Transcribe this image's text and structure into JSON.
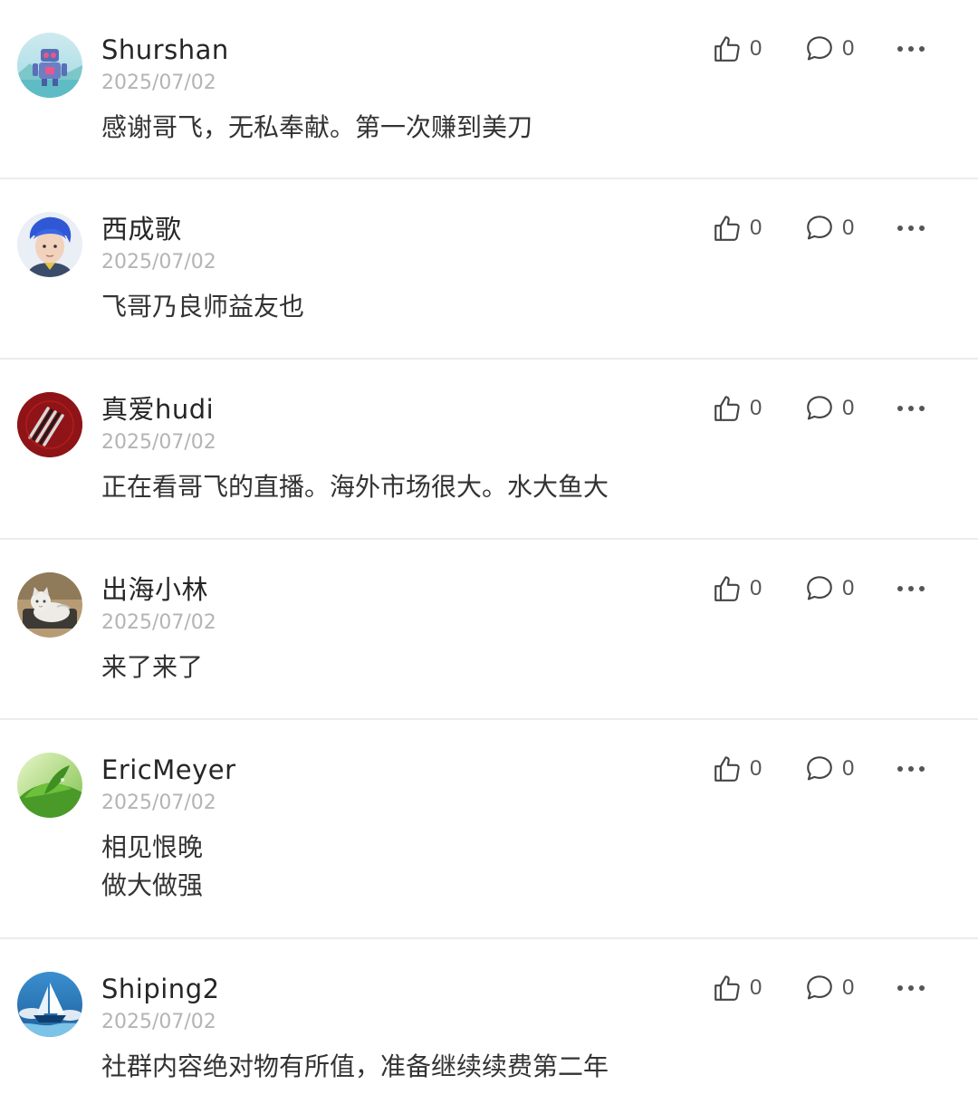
{
  "comments": [
    {
      "username": "Shurshan",
      "date": "2025/07/02",
      "text": [
        "感谢哥飞，无私奉献。第一次赚到美刀"
      ],
      "likes": "0",
      "replies": "0",
      "avatar": "robot-avatar"
    },
    {
      "username": "西成歌",
      "date": "2025/07/02",
      "text": [
        "飞哥乃良师益友也"
      ],
      "likes": "0",
      "replies": "0",
      "avatar": "person-blue-hair-avatar"
    },
    {
      "username": "真爱hudi",
      "date": "2025/07/02",
      "text": [
        "正在看哥飞的直播。海外市场很大。水大鱼大"
      ],
      "likes": "0",
      "replies": "0",
      "avatar": "red-stripe-logo-avatar"
    },
    {
      "username": "出海小林",
      "date": "2025/07/02",
      "text": [
        "来了来了"
      ],
      "likes": "0",
      "replies": "0",
      "avatar": "cat-avatar"
    },
    {
      "username": "EricMeyer",
      "date": "2025/07/02",
      "text": [
        "相见恨晚",
        "做大做强"
      ],
      "likes": "0",
      "replies": "0",
      "avatar": "green-leaf-avatar"
    },
    {
      "username": "Shiping2",
      "date": "2025/07/02",
      "text": [
        "社群内容绝对物有所值，准备继续续费第二年"
      ],
      "likes": "0",
      "replies": "0",
      "avatar": "sailboat-avatar"
    }
  ]
}
